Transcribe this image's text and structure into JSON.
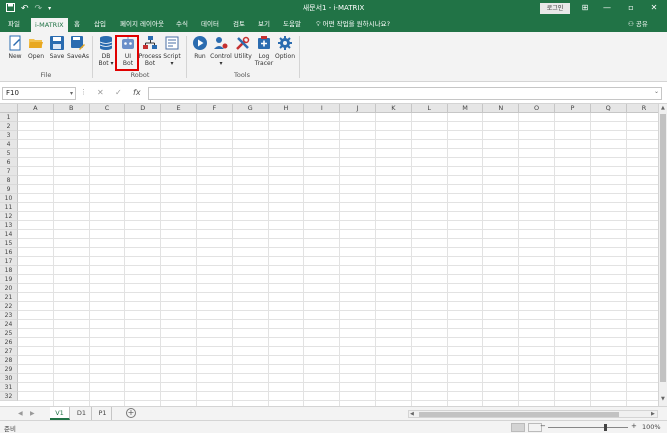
{
  "titlebar": {
    "title": "새문서1 - i-MATRIX",
    "login_label": "로그인",
    "save_icon": "save-icon",
    "undo_icon": "undo-icon",
    "redo_icon": "redo-icon",
    "customize_icon": "customize-icon",
    "window_controls": [
      "minimize",
      "restore",
      "close"
    ]
  },
  "tabs": [
    "파일",
    "i-MATRIX",
    "홈",
    "삽입",
    "페이지 레이아웃",
    "수식",
    "데이터",
    "검토",
    "보기",
    "도움말"
  ],
  "active_tab": "i-MATRIX",
  "search_placeholder": "어떤 작업을 원하시나요?",
  "share_label": "공유",
  "ribbon": {
    "groups": [
      {
        "label": "File",
        "buttons": [
          {
            "label": "New",
            "icon": "new-document-icon"
          },
          {
            "label": "Open",
            "icon": "folder-open-icon"
          },
          {
            "label": "Save",
            "icon": "save-disk-icon"
          },
          {
            "label": "SaveAs",
            "icon": "save-as-icon"
          }
        ]
      },
      {
        "label": "Robot",
        "buttons": [
          {
            "label": "DB Bot",
            "line1": "DB",
            "line2": "Bot ▾",
            "icon": "database-icon"
          },
          {
            "label": "UI Bot",
            "line1": "UI",
            "line2": "Bot",
            "icon": "robot-icon"
          },
          {
            "label": "Process Bot",
            "line1": "Process",
            "line2": "Bot",
            "icon": "process-flow-icon"
          },
          {
            "label": "Script",
            "line1": "Script",
            "line2": "▾",
            "icon": "script-icon"
          }
        ]
      },
      {
        "label": "Tools",
        "buttons": [
          {
            "label": "Run",
            "line1": "Run",
            "line2": "",
            "icon": "run-play-icon"
          },
          {
            "label": "Control",
            "line1": "Control",
            "line2": "▾",
            "icon": "control-user-icon"
          },
          {
            "label": "Utility",
            "line1": "Utility",
            "line2": "",
            "icon": "utility-tools-icon"
          },
          {
            "label": "Log Tracer",
            "line1": "Log",
            "line2": "Tracer",
            "icon": "log-tracer-icon"
          },
          {
            "label": "Option",
            "line1": "Option",
            "line2": "",
            "icon": "gear-icon"
          }
        ]
      }
    ]
  },
  "formula_bar": {
    "name_box": "F10",
    "cancel_icon": "cancel-x-icon",
    "enter_icon": "enter-check-icon",
    "function_icon": "fx",
    "formula": ""
  },
  "grid": {
    "columns": [
      "A",
      "B",
      "C",
      "D",
      "E",
      "F",
      "G",
      "H",
      "I",
      "J",
      "K",
      "L",
      "M",
      "N",
      "O",
      "P",
      "Q",
      "R"
    ],
    "rows": [
      "1",
      "2",
      "3",
      "4",
      "5",
      "6",
      "7",
      "8",
      "9",
      "10",
      "11",
      "12",
      "13",
      "14",
      "15",
      "16",
      "17",
      "18",
      "19",
      "20",
      "21",
      "22",
      "23",
      "24",
      "25",
      "26",
      "27",
      "28",
      "29",
      "30",
      "31",
      "32"
    ]
  },
  "sheets": [
    "V1",
    "D1",
    "P1"
  ],
  "active_sheet": "V1",
  "status": {
    "ready": "준비",
    "zoom_percent": "100%",
    "zoom_minus": "−",
    "zoom_plus": "+"
  },
  "colors": {
    "brand": "#217346",
    "highlight": "#e00000"
  }
}
